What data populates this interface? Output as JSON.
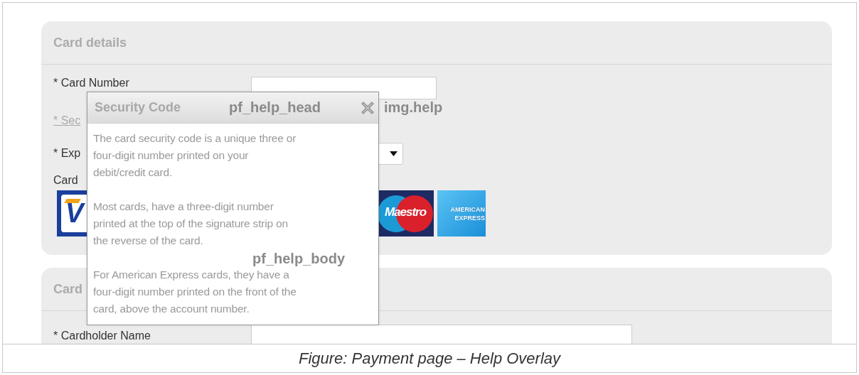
{
  "sections": [
    {
      "title": "Card details",
      "fields": [
        {
          "kind": "text",
          "label": "* Card Number"
        },
        {
          "kind": "link",
          "label": "* Sec"
        },
        {
          "kind": "select",
          "label": "* Exp"
        },
        {
          "kind": "logos",
          "label": "Card"
        }
      ]
    },
    {
      "title": "Card",
      "fields": [
        {
          "kind": "text",
          "label": "* Cardholder Name"
        }
      ]
    }
  ],
  "card_logos": [
    {
      "kind": "visa",
      "text": "V"
    },
    {
      "kind": "maestro",
      "text": "Maestro"
    },
    {
      "kind": "amex",
      "lines": [
        "AMERICAN",
        "EXPRESS"
      ]
    }
  ],
  "help_popup": {
    "title": "Security Code",
    "paragraphs": [
      {
        "lines": [
          "The card security code is a unique three or",
          "four-digit number printed on your",
          "debit/credit card."
        ]
      },
      {
        "lines": [
          "Most cards, have a three-digit number",
          "printed at the top of the signature strip on",
          "the reverse of the card."
        ]
      },
      {
        "lines": [
          "For American Express cards, they have a",
          "four-digit number printed on the front of the",
          "card, above the account number."
        ]
      }
    ]
  },
  "annotations": [
    {
      "kind": "head",
      "text": "pf_help_head"
    },
    {
      "kind": "img",
      "text": "img.help"
    },
    {
      "kind": "body",
      "text": "pf_help_body"
    }
  ],
  "caption": "Figure: Payment page – Help Overlay"
}
